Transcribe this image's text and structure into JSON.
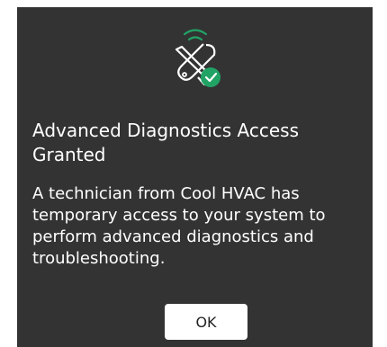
{
  "dialog": {
    "icon": "wrench-screwdriver-with-wireless-and-check-icon",
    "title": "Advanced Diagnostics Access Granted",
    "message": "A technician from Cool HVAC has temporary access to your system to perform advanced diagnostics and troubleshooting.",
    "ok_label": "OK"
  },
  "colors": {
    "dialog_background": "#333333",
    "accent_green": "#21a366",
    "text": "#ffffff",
    "button_background": "#ffffff"
  }
}
